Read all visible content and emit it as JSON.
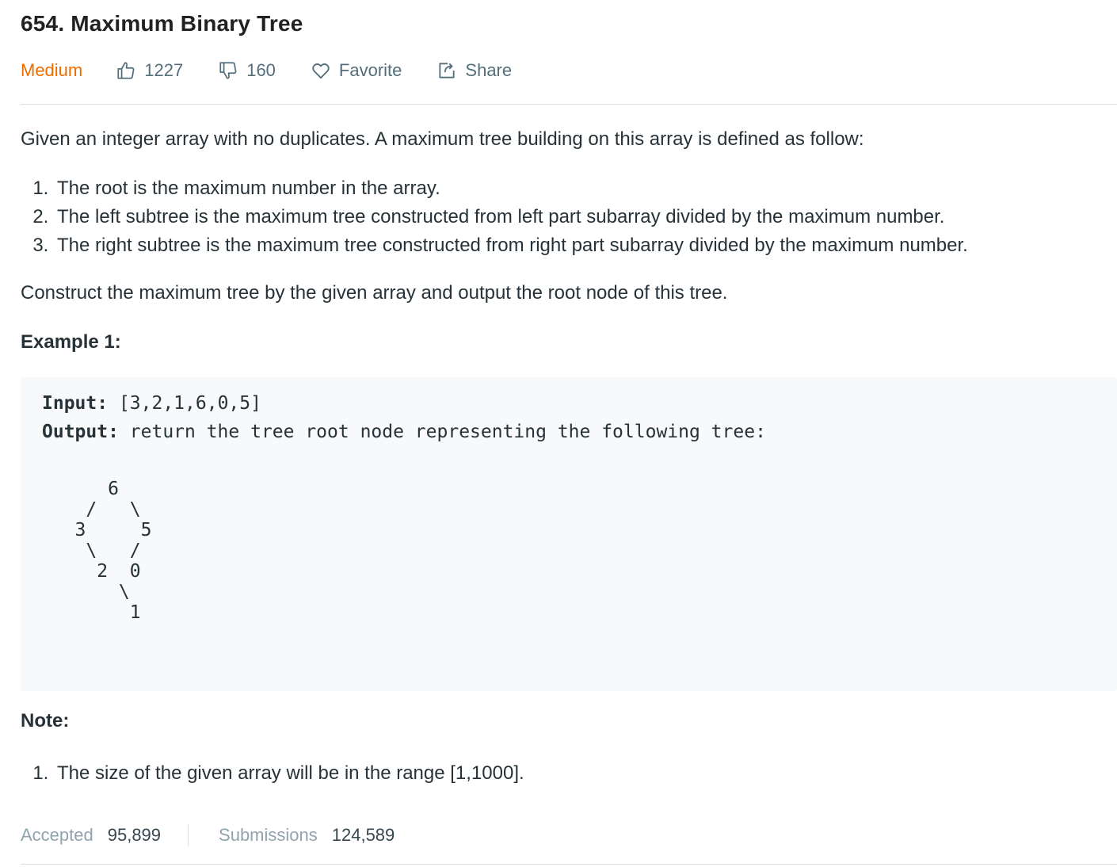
{
  "problem": {
    "title": "654. Maximum Binary Tree",
    "difficulty": "Medium",
    "likes": "1227",
    "dislikes": "160",
    "favorite_label": "Favorite",
    "share_label": "Share"
  },
  "colors": {
    "difficulty": "#ef6c00",
    "meta": "#546e7a",
    "code_bg": "#f7f9fa"
  },
  "description": {
    "intro": "Given an integer array with no duplicates. A maximum tree building on this array is defined as follow:",
    "rules": [
      "The root is the maximum number in the array.",
      "The left subtree is the maximum tree constructed from left part subarray divided by the maximum number.",
      "The right subtree is the maximum tree constructed from right part subarray divided by the maximum number."
    ],
    "task": "Construct the maximum tree by the given array and output the root node of this tree."
  },
  "example": {
    "title": "Example 1:",
    "input_label": "Input:",
    "input_value": " [3,2,1,6,0,5]",
    "output_label": "Output:",
    "output_value": " return the tree root node representing the following tree:",
    "tree": "      6\n    /   \\\n   3     5\n    \\   /\n     2  0\n       \\\n        1"
  },
  "note": {
    "title": "Note:",
    "items": [
      "The size of the given array will be in the range [1,1000]."
    ]
  },
  "stats": {
    "accepted_label": "Accepted",
    "accepted_value": "95,899",
    "submissions_label": "Submissions",
    "submissions_value": "124,589"
  }
}
